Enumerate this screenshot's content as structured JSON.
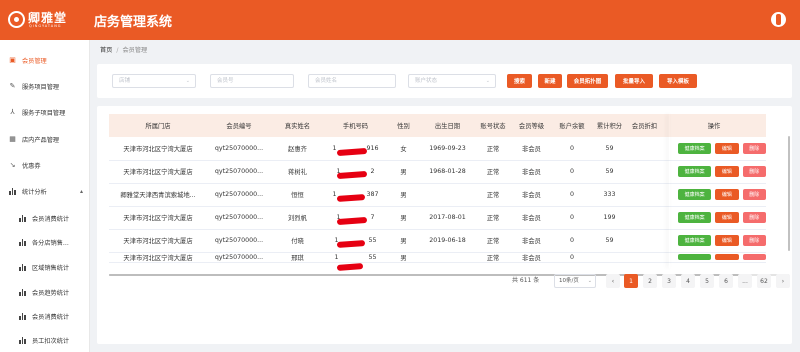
{
  "header": {
    "logo_text": "卿雅堂",
    "logo_sub": "QINGYATANG",
    "app_title": "店务管理系统"
  },
  "sidebar": {
    "items": [
      {
        "label": "会员管理",
        "icon": "member-icon",
        "active": true
      },
      {
        "label": "服务项目管理",
        "icon": "edit-icon"
      },
      {
        "label": "服务子项目管理",
        "icon": "subproject-icon"
      },
      {
        "label": "店内产品管理",
        "icon": "product-icon"
      },
      {
        "label": "优惠券",
        "icon": "coupon-icon"
      },
      {
        "label": "统计分析",
        "icon": "chart-icon",
        "caret": "▴"
      },
      {
        "label": "会员消费统计",
        "icon": "bar-chart-icon"
      },
      {
        "label": "各分店销售...",
        "icon": "bar-chart-icon"
      },
      {
        "label": "区域销售统计",
        "icon": "bar-chart-icon"
      },
      {
        "label": "会员趋势统计",
        "icon": "bar-chart-icon"
      },
      {
        "label": "会员消费统计",
        "icon": "bar-chart-icon"
      },
      {
        "label": "员工扣次统计",
        "icon": "bar-chart-icon"
      }
    ]
  },
  "breadcrumb": {
    "home": "首页",
    "sep": "/",
    "current": "会员管理"
  },
  "filters": {
    "store_placeholder": "店铺",
    "member_no_placeholder": "会员号",
    "member_name_placeholder": "会员姓名",
    "account_status_placeholder": "账户状态",
    "chevron": "⌄"
  },
  "toolbar": {
    "search": "搜索",
    "add": "新建",
    "member_graph": "会员拓扑图",
    "batch_import": "批量导入",
    "import_template": "导入模板"
  },
  "table": {
    "columns": [
      "所属门店",
      "会员编号",
      "真实姓名",
      "手机号码",
      "性别",
      "出生日期",
      "账号状态",
      "会员等级",
      "账户余额",
      "累计积分",
      "会员折扣",
      "操作"
    ],
    "rows": [
      {
        "store": "天津市河北区宁湾大厦店",
        "no": "qyt25070000...",
        "name": "赵惠齐",
        "phone": "1",
        "phone_tail": "916",
        "gender": "女",
        "birth": "1969-09-23",
        "status": "正常",
        "level": "非会员",
        "balance": "0",
        "points": "59",
        "discount": ""
      },
      {
        "store": "天津市河北区宁湾大厦店",
        "no": "qyt25070000...",
        "name": "蒋树礼",
        "phone": "1",
        "phone_tail": "2",
        "gender": "男",
        "birth": "1968-01-28",
        "status": "正常",
        "level": "非会员",
        "balance": "0",
        "points": "59",
        "discount": ""
      },
      {
        "store": "卿雅堂天津西青滨索城地...",
        "no": "qyt25070000...",
        "name": "恒恒",
        "phone": "1",
        "phone_tail": "387",
        "gender": "男",
        "birth": "",
        "status": "正常",
        "level": "非会员",
        "balance": "0",
        "points": "333",
        "discount": ""
      },
      {
        "store": "天津市河北区宁湾大厦店",
        "no": "qyt25070000...",
        "name": "刘烈帆",
        "phone": "1",
        "phone_tail": "7",
        "gender": "男",
        "birth": "2017-08-01",
        "status": "正常",
        "level": "非会员",
        "balance": "0",
        "points": "199",
        "discount": ""
      },
      {
        "store": "天津市河北区宁湾大厦店",
        "no": "qyt25070000...",
        "name": "付晓",
        "phone": "1",
        "phone_tail": "55",
        "gender": "男",
        "birth": "2019-06-18",
        "status": "正常",
        "level": "非会员",
        "balance": "0",
        "points": "59",
        "discount": ""
      },
      {
        "store": "天津市河北区宁湾大厦店",
        "no": "qyt25070000...",
        "name": "邢琪",
        "phone": "1",
        "phone_tail": "55",
        "gender": "男",
        "birth": "",
        "status": "正常",
        "level": "非会员",
        "balance": "0",
        "points": "",
        "discount": ""
      }
    ],
    "actions": {
      "health": "健康档案",
      "edit": "编辑",
      "delete": "删除"
    }
  },
  "pagination": {
    "total": "共 611 条",
    "page_size": "10条/页",
    "prev": "‹",
    "pages": [
      "1",
      "2",
      "3",
      "4",
      "5",
      "6",
      "...",
      "62"
    ],
    "current": "1",
    "next": "›"
  },
  "colors": {
    "brand": "#ea5a25",
    "health": "#4db33f",
    "delete": "#f56c6c"
  }
}
